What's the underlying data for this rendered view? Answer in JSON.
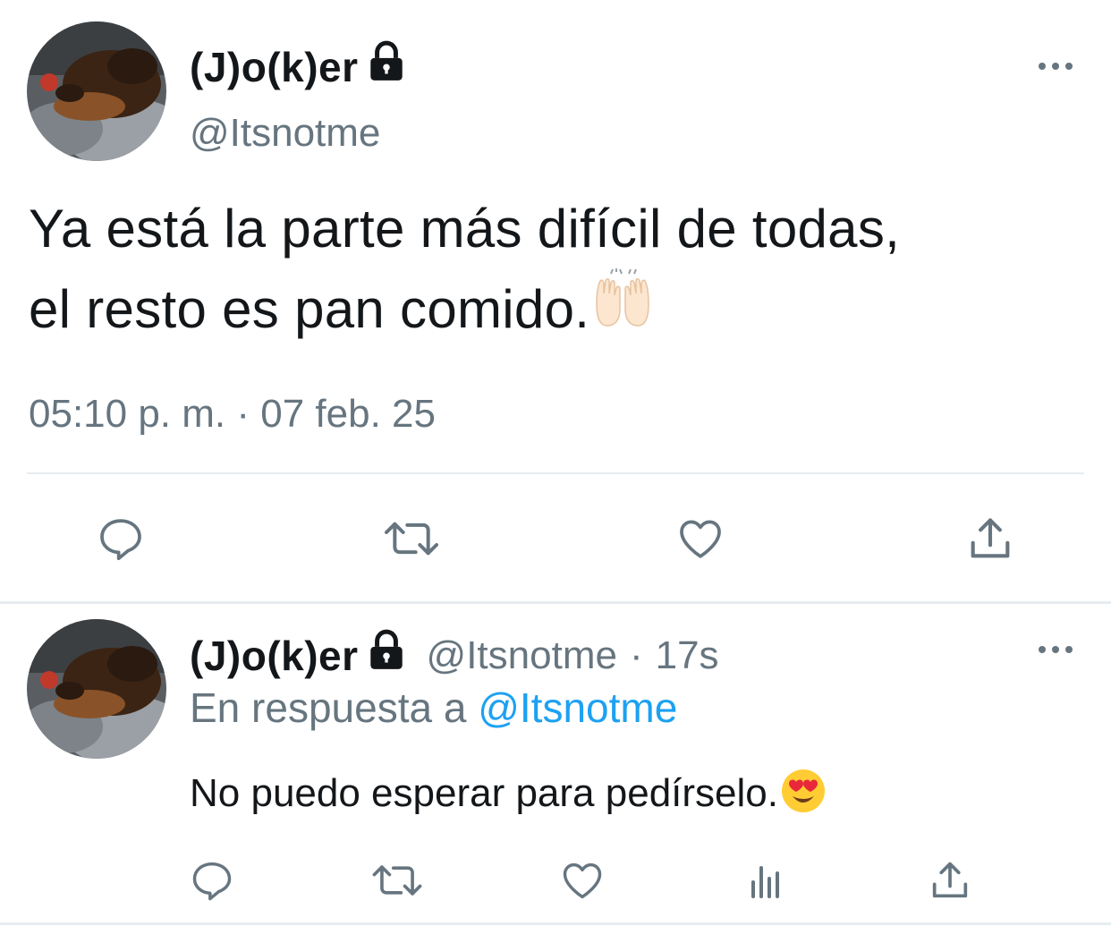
{
  "main_tweet": {
    "author_name": "(J)o(k)er",
    "author_handle": "@Itsnotme",
    "text_line1": "Ya está la parte más difícil de todas,",
    "text_line2": "el resto es pan comido.",
    "text_emoji": "raising-hands-emoji",
    "time": "05:10 p. m.",
    "separator": "·",
    "date": "07 feb. 25"
  },
  "reply_tweet": {
    "author_name": "(J)o(k)er",
    "author_handle": "@Itsnotme",
    "separator": "·",
    "age": "17s",
    "replying_prefix": "En respuesta a",
    "replying_to": "@Itsnotme",
    "text": "No puedo esperar para pedírselo.",
    "text_emoji": "smiling-face-with-heart-eyes-emoji"
  },
  "icons": {
    "lock": "lock-icon",
    "more": "more-icon",
    "reply": "reply-icon",
    "retweet": "retweet-icon",
    "like": "like-icon",
    "share": "share-icon",
    "analytics": "analytics-icon"
  },
  "colors": {
    "text": "#14171a",
    "secondary": "#66757f",
    "link": "#1da1f2",
    "divider": "#e6ecf0"
  }
}
